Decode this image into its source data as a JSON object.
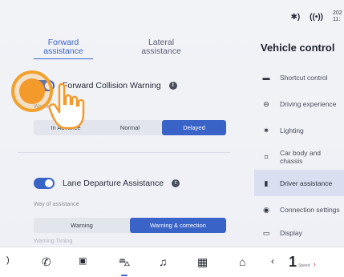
{
  "status_bar": {
    "clock_top": "202",
    "clock_bottom": "11:"
  },
  "tabs": [
    {
      "label": "Forward\nassistance",
      "active": true
    },
    {
      "label": "Lateral\nassistance",
      "active": false
    }
  ],
  "fcw": {
    "label": "Forward Collision Warning",
    "enabled": true,
    "timing_label": "Warnin",
    "timing_options": [
      "In Advance",
      "Normal",
      "Delayed"
    ],
    "selected": "Delayed"
  },
  "lda": {
    "label": "Lane Departure Assistance",
    "enabled": true,
    "way_label": "Way of assistance",
    "options": [
      "Warning",
      "Warning & correction"
    ],
    "selected": "Warning & correction",
    "timing_label": "Warning Timing"
  },
  "sidebar": {
    "title": "Vehicle control",
    "items": [
      {
        "label": "Shortcut control",
        "icon": "car-icon"
      },
      {
        "label": "Driving experience",
        "icon": "steering-wheel-icon"
      },
      {
        "label": "Lighting",
        "icon": "light-icon"
      },
      {
        "label": "Car body and\nchassis",
        "icon": "chassis-icon"
      },
      {
        "label": "Driver assistance",
        "icon": "driver-assist-icon",
        "active": true
      },
      {
        "label": "Connection settings",
        "icon": "connection-icon"
      },
      {
        "label": "Display",
        "icon": "display-icon"
      }
    ]
  },
  "bottom_bar": {
    "speed_value": "1",
    "speed_sub": "Speed"
  },
  "colors": {
    "accent": "#3a63c8",
    "tap_orange": "#f39a2b"
  }
}
